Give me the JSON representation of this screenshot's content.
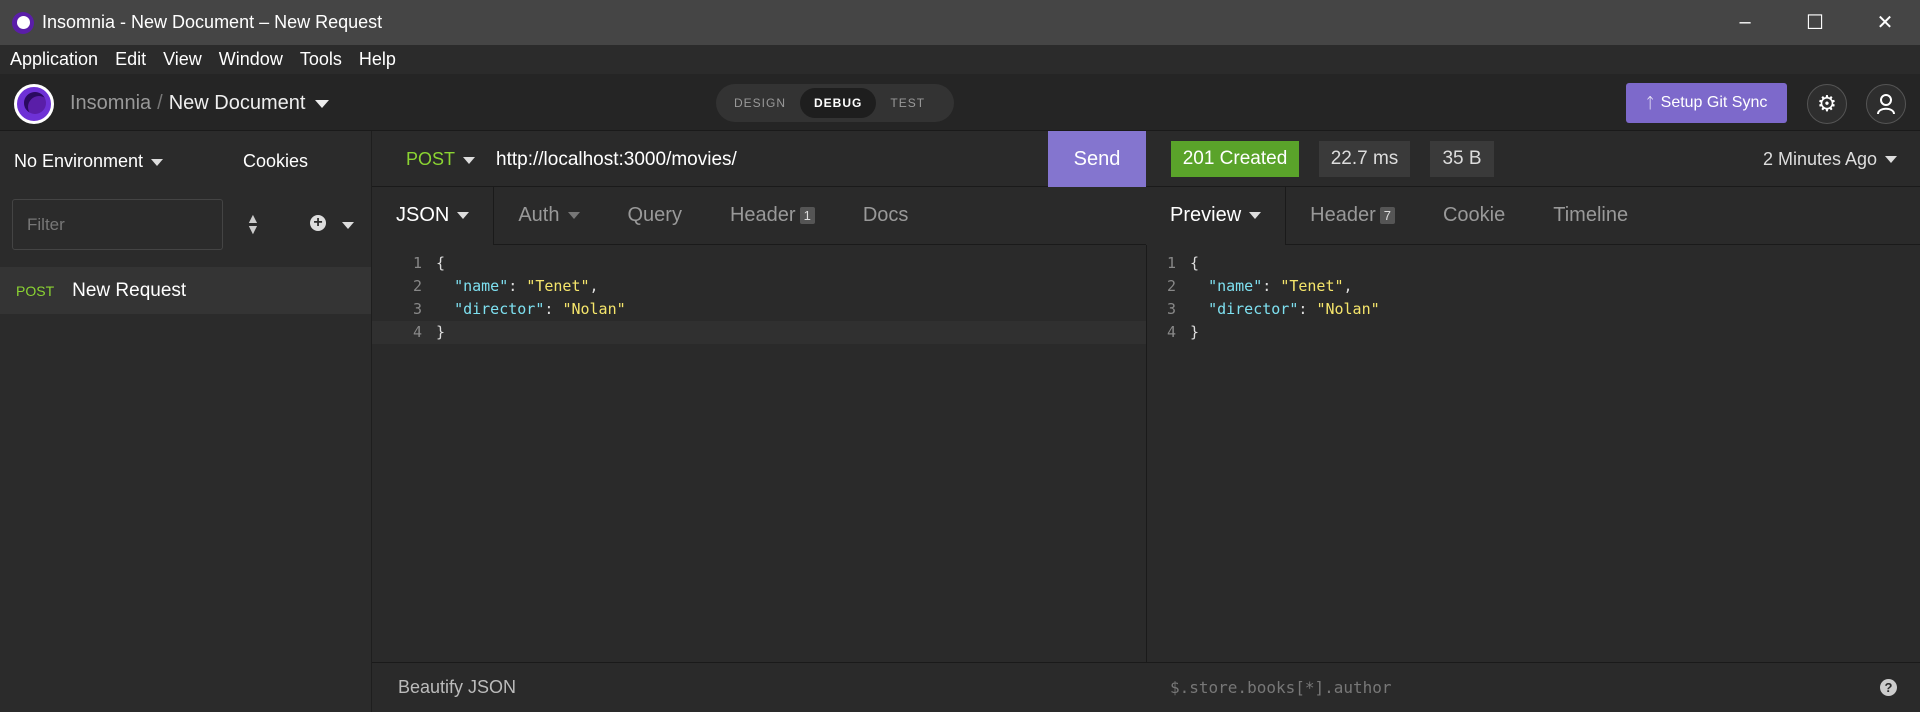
{
  "window": {
    "title": "Insomnia - New Document – New Request"
  },
  "menu": [
    "Application",
    "Edit",
    "View",
    "Window",
    "Tools",
    "Help"
  ],
  "header": {
    "breadcrumb_root": "Insomnia",
    "breadcrumb_sep": "/",
    "breadcrumb_doc": "New Document",
    "modes": [
      "DESIGN",
      "DEBUG",
      "TEST"
    ],
    "active_mode": "DEBUG",
    "git_sync_label": "Setup Git Sync"
  },
  "sidebar": {
    "environment": "No Environment",
    "cookies_label": "Cookies",
    "filter_placeholder": "Filter",
    "requests": [
      {
        "method": "POST",
        "name": "New Request"
      }
    ]
  },
  "request": {
    "method": "POST",
    "url": "http://localhost:3000/movies/",
    "send_label": "Send",
    "tabs": [
      "JSON",
      "Auth",
      "Query",
      "Header",
      "Docs"
    ],
    "header_count": "1",
    "body_lines": [
      {
        "n": "1",
        "text": "{"
      },
      {
        "n": "2",
        "key": "\"name\"",
        "value": "\"Tenet\"",
        "comma": ","
      },
      {
        "n": "3",
        "key": "\"director\"",
        "value": "\"Nolan\"",
        "comma": ""
      },
      {
        "n": "4",
        "text": "}"
      }
    ],
    "footer_label": "Beautify JSON"
  },
  "response": {
    "status": "201 Created",
    "status_color": "#5aa32a",
    "time": "22.7 ms",
    "size": "35 B",
    "age": "2 Minutes Ago",
    "tabs": [
      "Preview",
      "Header",
      "Cookie",
      "Timeline"
    ],
    "header_count": "7",
    "filter_placeholder": "$.store.books[*].author"
  }
}
